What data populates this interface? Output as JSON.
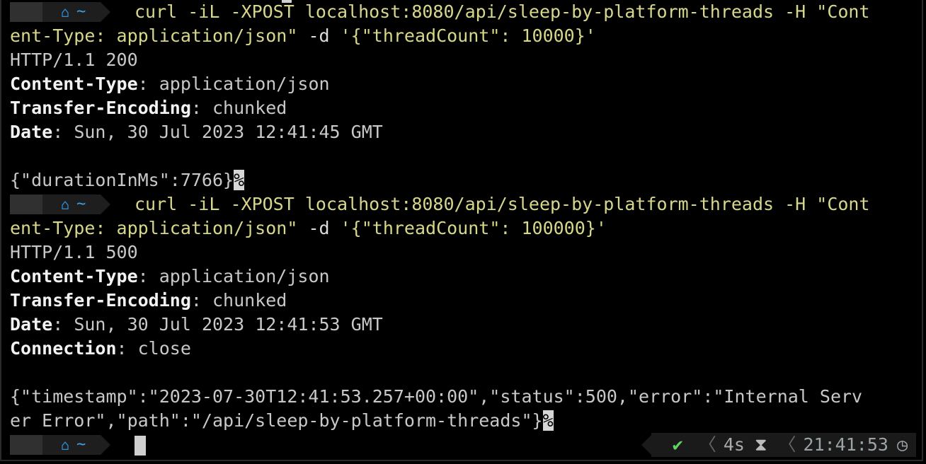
{
  "prompt": {
    "apple_icon": "apple-icon",
    "home_icon": "home-icon",
    "dir": "~"
  },
  "session": [
    {
      "cmd_a": "curl -iL -XPOST localhost:8080/api/sleep-by-platform-threads -H ",
      "cmd_b": "\"Cont",
      "cmd_wrap_y": "ent-Type: application/json\"",
      "cmd_wrap_w": " -d ",
      "cmd_wrap_y2": "'{\"threadCount\": 10000}'",
      "status": "HTTP/1.1 200",
      "headers": [
        {
          "k": "Content-Type",
          "v": "application/json"
        },
        {
          "k": "Transfer-Encoding",
          "v": "chunked"
        },
        {
          "k": "Date",
          "v": "Sun, 30 Jul 2023 12:41:45 GMT"
        }
      ],
      "body": "{\"durationInMs\":7766}",
      "eol": "%"
    },
    {
      "cmd_a": "curl -iL -XPOST localhost:8080/api/sleep-by-platform-threads -H ",
      "cmd_b": "\"Cont",
      "cmd_wrap_y": "ent-Type: application/json\"",
      "cmd_wrap_w": " -d ",
      "cmd_wrap_y2": "'{\"threadCount\": 100000}'",
      "status": "HTTP/1.1 500",
      "headers": [
        {
          "k": "Content-Type",
          "v": "application/json"
        },
        {
          "k": "Transfer-Encoding",
          "v": "chunked"
        },
        {
          "k": "Date",
          "v": "Sun, 30 Jul 2023 12:41:53 GMT"
        },
        {
          "k": "Connection",
          "v": "close"
        }
      ],
      "body_1": "{\"timestamp\":\"2023-07-30T12:41:53.257+00:00\",\"status\":500,\"error\":\"Internal Serv",
      "body_2": "er Error\",\"path\":\"/api/sleep-by-platform-threads\"}",
      "eol": "%"
    }
  ],
  "right_status": {
    "check": "✔",
    "duration": "4s",
    "clock": "21:41:53"
  }
}
